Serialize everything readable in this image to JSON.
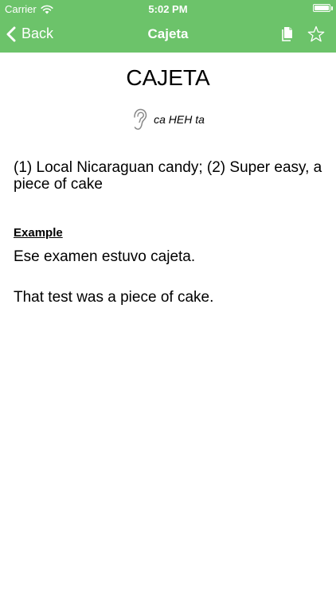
{
  "status_bar": {
    "carrier": "Carrier",
    "time": "5:02 PM",
    "battery_level": 1.0
  },
  "nav": {
    "back_label": "Back",
    "title": "Cajeta",
    "icons": {
      "back": "chevron-left-icon",
      "document": "document-icon",
      "favorite": "star-icon"
    }
  },
  "entry": {
    "word": "CAJETA",
    "pronunciation": "ca HEH ta",
    "definition": "(1) Local Nicaraguan candy; (2) Super easy, a piece of cake",
    "example_heading": "Example",
    "example_spanish": "Ese examen estuvo cajeta.",
    "example_english": "That test was a piece of cake."
  },
  "colors": {
    "header_green": "#6cc36a",
    "header_text": "#ffffff",
    "body_text": "#000000",
    "background": "#ffffff"
  }
}
